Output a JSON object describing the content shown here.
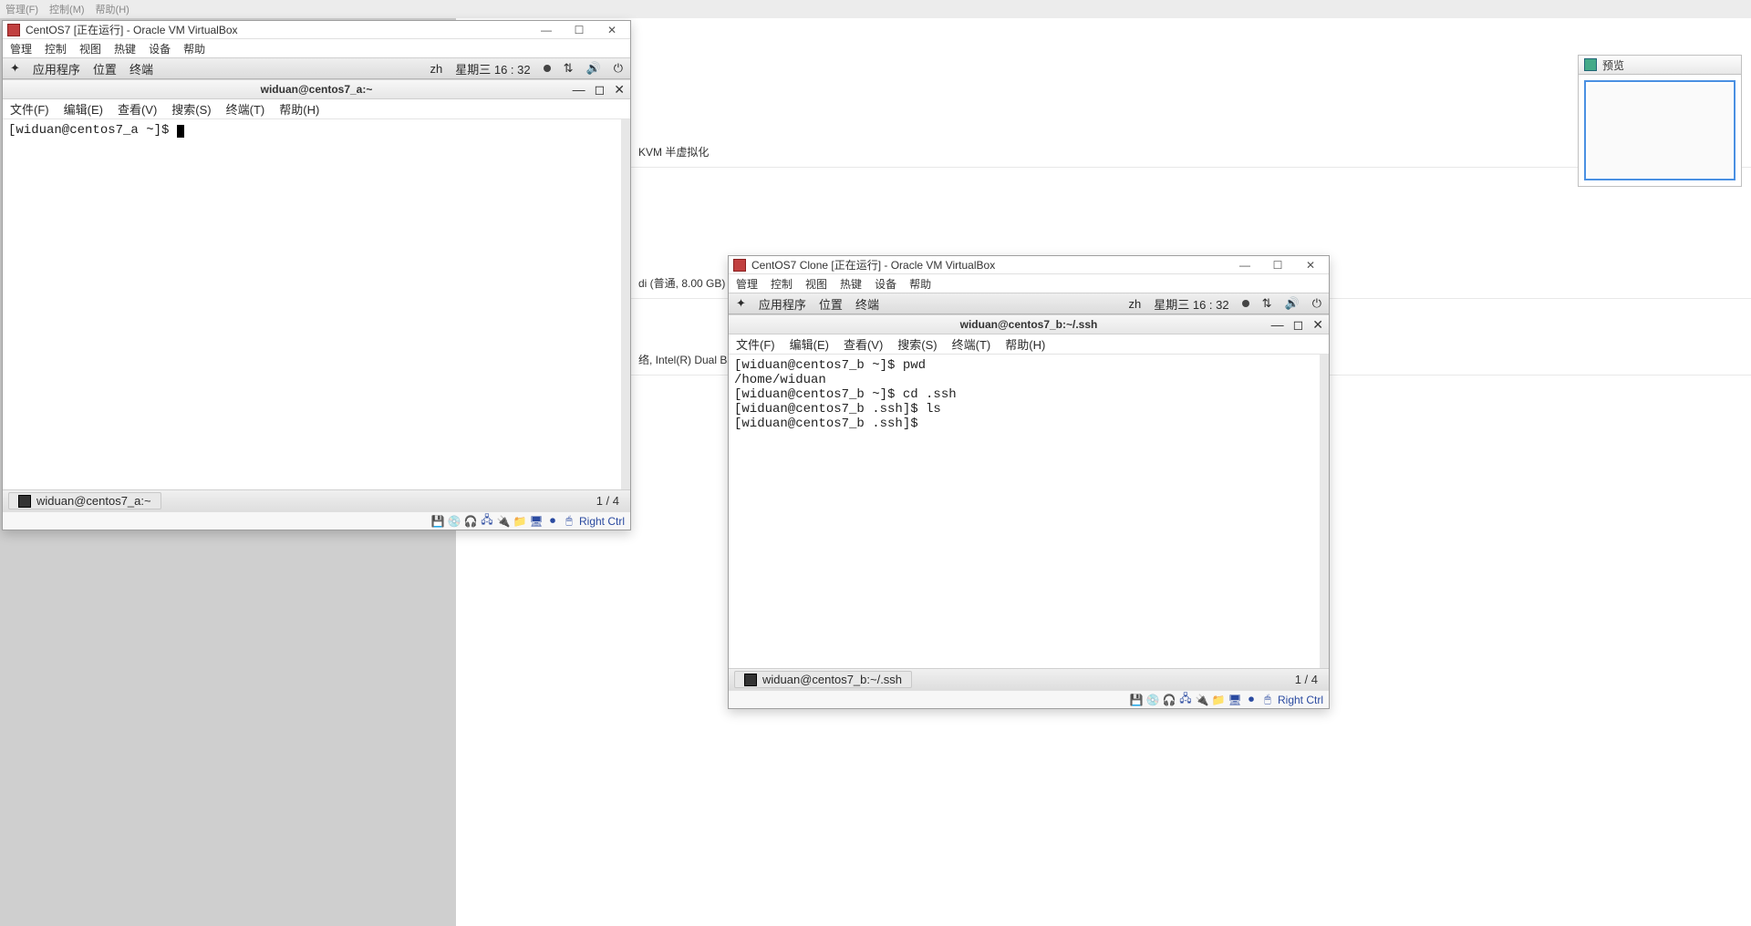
{
  "host_menubar": {
    "items": [
      "管理(F)",
      "控制(M)",
      "帮助(H)"
    ]
  },
  "preview": {
    "title": "预览"
  },
  "background_rows": {
    "kvm": "KVM 半虚拟化",
    "disk": "di (普通, 8.00 GB)",
    "net": "络, Intel(R) Dual Band"
  },
  "vm_a": {
    "title": "CentOS7 [正在运行] - Oracle VM VirtualBox",
    "menu": [
      "管理",
      "控制",
      "视图",
      "热键",
      "设备",
      "帮助"
    ],
    "gnome_top": {
      "apps": "应用程序",
      "places": "位置",
      "terminal": "终端",
      "lang": "zh",
      "datetime": "星期三 16 : 32"
    },
    "term_title": "widuan@centos7_a:~",
    "term_menu": [
      "文件(F)",
      "编辑(E)",
      "查看(V)",
      "搜索(S)",
      "终端(T)",
      "帮助(H)"
    ],
    "term_lines": [
      "[widuan@centos7_a ~]$ "
    ],
    "task_label": "widuan@centos7_a:~",
    "workspace": "1 / 4",
    "host_key": "Right Ctrl"
  },
  "vm_b": {
    "title": "CentOS7 Clone [正在运行] - Oracle VM VirtualBox",
    "menu": [
      "管理",
      "控制",
      "视图",
      "热键",
      "设备",
      "帮助"
    ],
    "gnome_top": {
      "apps": "应用程序",
      "places": "位置",
      "terminal": "终端",
      "lang": "zh",
      "datetime": "星期三 16 : 32"
    },
    "term_title": "widuan@centos7_b:~/.ssh",
    "term_menu": [
      "文件(F)",
      "编辑(E)",
      "查看(V)",
      "搜索(S)",
      "终端(T)",
      "帮助(H)"
    ],
    "term_lines": [
      "[widuan@centos7_b ~]$ pwd",
      "/home/widuan",
      "[widuan@centos7_b ~]$ cd .ssh",
      "[widuan@centos7_b .ssh]$ ls",
      "[widuan@centos7_b .ssh]$ "
    ],
    "task_label": "widuan@centos7_b:~/.ssh",
    "workspace": "1 / 4",
    "host_key": "Right Ctrl"
  }
}
